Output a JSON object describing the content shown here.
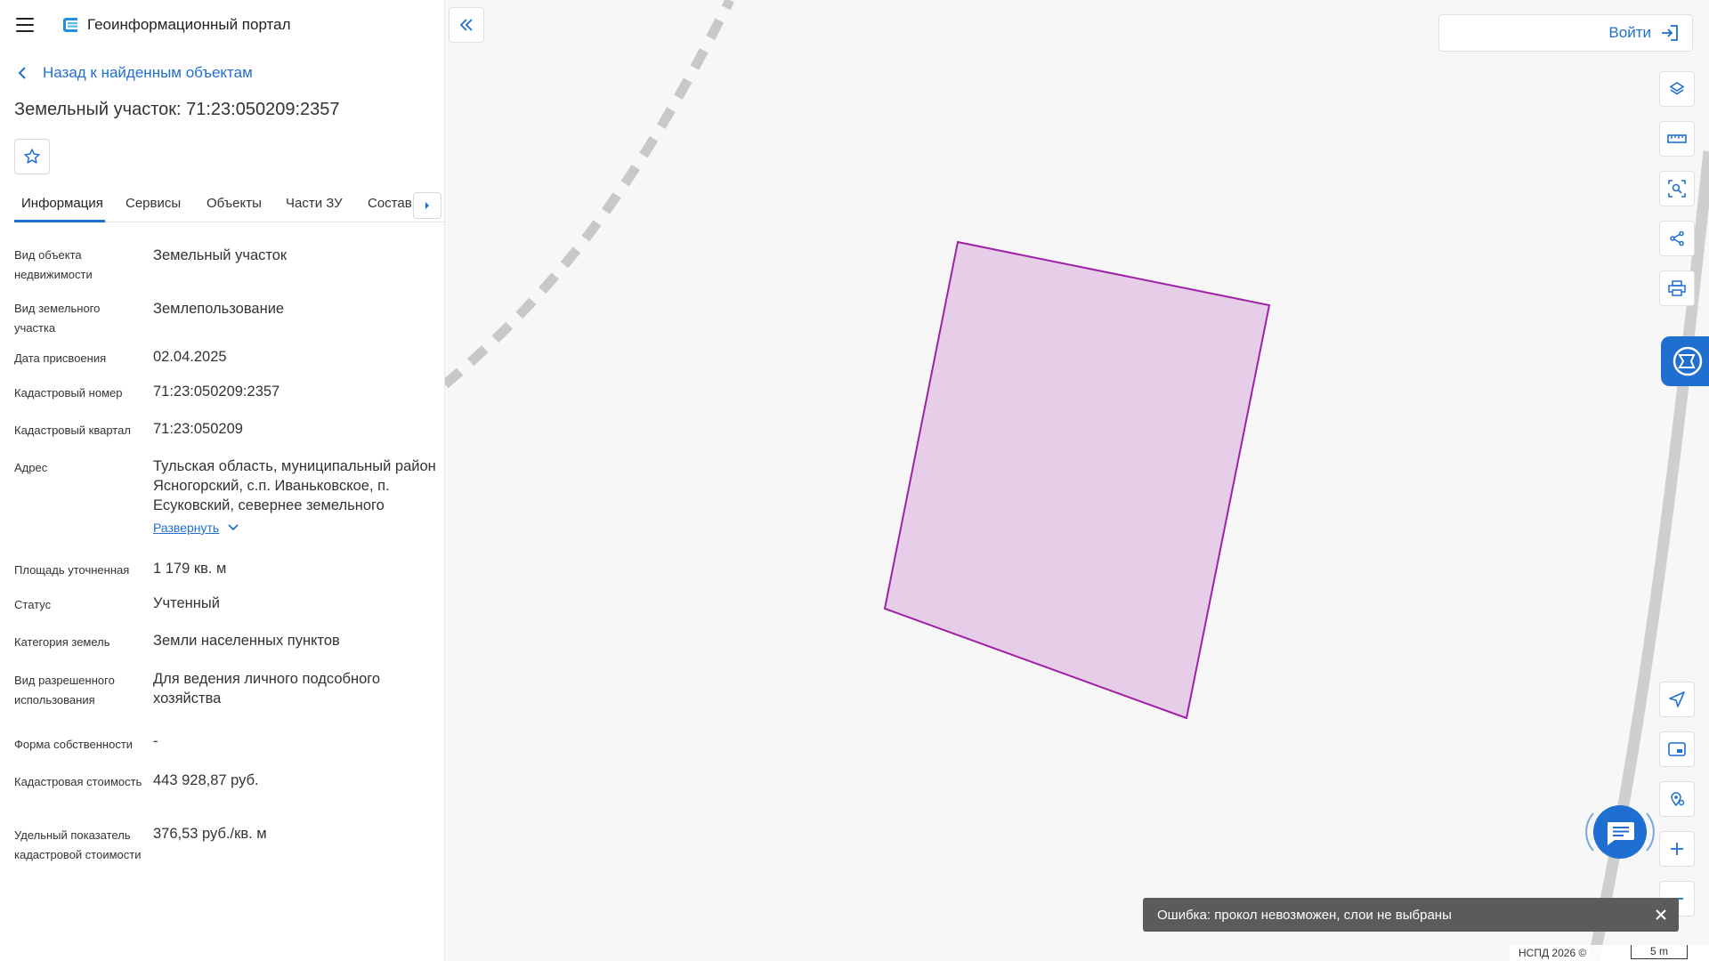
{
  "header": {
    "portal_title": "Геоинформационный портал",
    "menu_icon": "hamburger-icon",
    "logo_icon": "portal-logo-icon"
  },
  "nav": {
    "back_label": "Назад к найденным объектам"
  },
  "object": {
    "title": "Земельный участок: 71:23:050209:2357"
  },
  "tabs": [
    {
      "label": "Информация",
      "active": true
    },
    {
      "label": "Сервисы"
    },
    {
      "label": "Объекты"
    },
    {
      "label": "Части ЗУ"
    },
    {
      "label": "Состав"
    }
  ],
  "info": [
    {
      "label": "Вид объекта недвижимости",
      "value": "Земельный участок"
    },
    {
      "label": "Вид земельного участка",
      "value": "Землепользование"
    },
    {
      "label": "Дата присвоения",
      "value": "02.04.2025"
    },
    {
      "label": "Кадастровый номер",
      "value": "71:23:050209:2357"
    },
    {
      "label": "Кадастровый квартал",
      "value": "71:23:050209"
    },
    {
      "label": "Адрес",
      "value": "Тульская область, муниципальный район Ясногорский, с.п. Иваньковское, п. Есуковский, севернее земельного",
      "expand_label": "Развернуть"
    },
    {
      "label": "Площадь уточненная",
      "value": "1 179 кв. м"
    },
    {
      "label": "Статус",
      "value": "Учтенный"
    },
    {
      "label": "Категория земель",
      "value": "Земли населенных пунктов"
    },
    {
      "label": "Вид разрешенного использования",
      "value": "Для ведения личного подсобного хозяйства"
    },
    {
      "label": "Форма собственности",
      "value": "-"
    },
    {
      "label": "Кадастровая стоимость",
      "value": "443 928,87 руб."
    },
    {
      "label": "Удельный показатель кадастровой стоимости",
      "value": "376,53 руб./кв. м"
    }
  ],
  "map": {
    "login_label": "Войти",
    "parcel_fill": "#e6cde8",
    "parcel_stroke": "#a020a8",
    "accent": "#1f6fd1"
  },
  "toast": {
    "message": "Ошибка: прокол невозможен, слои не выбраны"
  },
  "footer": {
    "copyright": "НСПД 2026 ©",
    "scale": "5 m"
  }
}
